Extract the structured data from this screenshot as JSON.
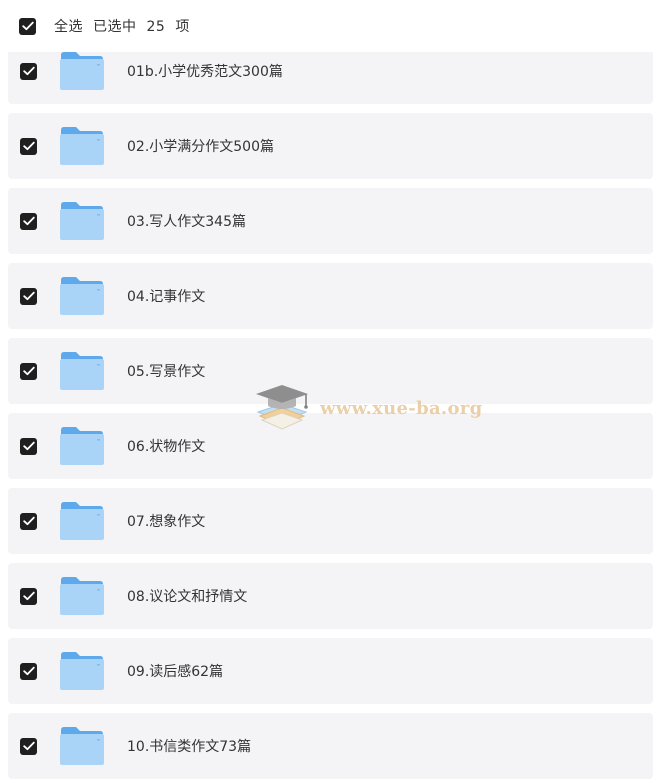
{
  "header": {
    "select_all_label": "全选",
    "selected_prefix": "已选中",
    "selected_count": "25",
    "selected_suffix": "项"
  },
  "items": [
    {
      "label": "01b.小学优秀范文300篇",
      "checked": true,
      "icon": "folder-icon"
    },
    {
      "label": "02.小学满分作文500篇",
      "checked": true,
      "icon": "folder-icon"
    },
    {
      "label": "03.写人作文345篇",
      "checked": true,
      "icon": "folder-icon"
    },
    {
      "label": "04.记事作文",
      "checked": true,
      "icon": "folder-icon"
    },
    {
      "label": "05.写景作文",
      "checked": true,
      "icon": "folder-icon"
    },
    {
      "label": "06.状物作文",
      "checked": true,
      "icon": "folder-icon"
    },
    {
      "label": "07.想象作文",
      "checked": true,
      "icon": "folder-icon"
    },
    {
      "label": "08.议论文和抒情文",
      "checked": true,
      "icon": "folder-icon"
    },
    {
      "label": "09.读后感62篇",
      "checked": true,
      "icon": "folder-icon"
    },
    {
      "label": "10.书信类作文73篇",
      "checked": true,
      "icon": "folder-icon"
    }
  ],
  "watermark": {
    "text": "www.xue-ba.org",
    "icon": "graduation-cap-books-icon"
  },
  "colors": {
    "checkbox": "#1f1f1f",
    "row_background": "#f4f4f6",
    "folder_light": "#a9d4f7",
    "folder_dark": "#5ea9ec",
    "text": "#333333"
  }
}
